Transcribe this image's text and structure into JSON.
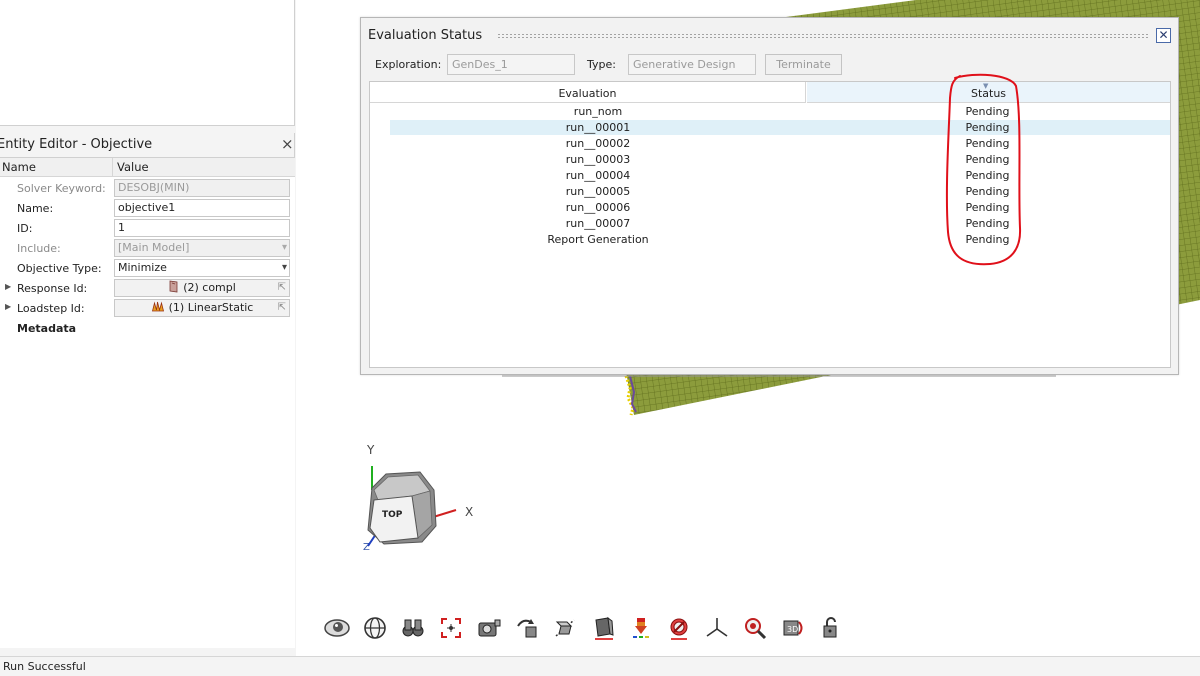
{
  "entity_editor": {
    "title": "Entity Editor - Objective",
    "close_glyph": "×",
    "headers": {
      "name": "Name",
      "value": "Value"
    },
    "rows": [
      {
        "label": "Solver Keyword:",
        "value": "DESOBJ(MIN)",
        "kind": "readonly"
      },
      {
        "label": "Name:",
        "value": "objective1",
        "kind": "text"
      },
      {
        "label": "ID:",
        "value": "1",
        "kind": "text"
      },
      {
        "label": "Include:",
        "value": "[Main Model]",
        "kind": "select-disabled"
      },
      {
        "label": "Objective Type:",
        "value": "Minimize",
        "kind": "select"
      },
      {
        "label": "Response Id:",
        "value": "(2) compl",
        "kind": "reference",
        "icon": "response-icon"
      },
      {
        "label": "Loadstep Id:",
        "value": "(1) LinearStatic",
        "kind": "reference",
        "icon": "loadstep-icon"
      },
      {
        "label": "Metadata",
        "kind": "section"
      }
    ]
  },
  "status_bar": {
    "text": "Run Successful"
  },
  "evaluation_dialog": {
    "title": "Evaluation Status",
    "exploration_label": "Exploration:",
    "exploration_value": "GenDes_1",
    "type_label": "Type:",
    "type_value": "Generative Design",
    "terminate_label": "Terminate",
    "columns": {
      "evaluation": "Evaluation",
      "status": "Status"
    },
    "rows": [
      {
        "evaluation": "run_nom",
        "status": "Pending"
      },
      {
        "evaluation": "run__00001",
        "status": "Pending",
        "selected": true
      },
      {
        "evaluation": "run__00002",
        "status": "Pending"
      },
      {
        "evaluation": "run__00003",
        "status": "Pending"
      },
      {
        "evaluation": "run__00004",
        "status": "Pending"
      },
      {
        "evaluation": "run__00005",
        "status": "Pending"
      },
      {
        "evaluation": "run__00006",
        "status": "Pending"
      },
      {
        "evaluation": "run__00007",
        "status": "Pending"
      },
      {
        "evaluation": "Report Generation",
        "status": "Pending"
      }
    ]
  },
  "view_cube": {
    "face_label": "TOP",
    "axis_x": "X",
    "axis_y": "Y",
    "axis_z": "Z"
  },
  "toolbar": {
    "buttons": [
      "visualization-eye-icon",
      "globe-icon",
      "binoculars-icon",
      "focus-target-icon",
      "camera-icon",
      "rotate-view-icon",
      "section-cut-icon",
      "shaded-view-icon",
      "color-legend-icon",
      "no-entity-icon",
      "triad-icon",
      "zoom-icon",
      "view-3d-icon",
      "lock-icon"
    ]
  },
  "colors": {
    "mesh": "#8c9c3c",
    "mesh_line": "#6b7a22",
    "annotation": "#e0101a",
    "selection": "#dff0f8",
    "status_header": "#eaf4fb"
  }
}
